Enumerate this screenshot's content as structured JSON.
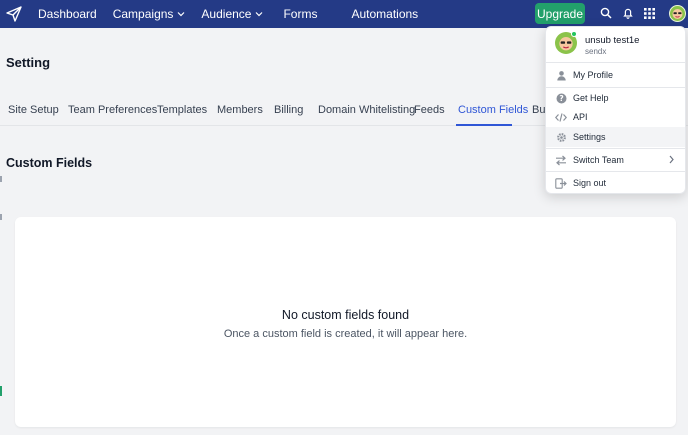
{
  "nav": {
    "items": [
      {
        "label": "Dashboard"
      },
      {
        "label": "Campaigns"
      },
      {
        "label": "Audience"
      },
      {
        "label": "Forms"
      },
      {
        "label": "Automations"
      }
    ],
    "upgrade_label": "Upgrade"
  },
  "page": {
    "title": "Setting",
    "section_title": "Custom Fields"
  },
  "tabs": [
    {
      "label": "Site Setup"
    },
    {
      "label": "Team Preferences"
    },
    {
      "label": "Templates"
    },
    {
      "label": "Members"
    },
    {
      "label": "Billing"
    },
    {
      "label": "Domain Whitelisting"
    },
    {
      "label": "Feeds"
    },
    {
      "label": "Custom Fields",
      "active": true
    },
    {
      "label": "Bul"
    }
  ],
  "empty_state": {
    "title": "No custom fields found",
    "subtitle": "Once a custom field is created, it will appear here."
  },
  "user_menu": {
    "name": "unsub test1e",
    "org": "sendx",
    "items": [
      {
        "label": "My Profile",
        "icon": "user-icon"
      },
      {
        "label": "Get Help",
        "icon": "help-icon"
      },
      {
        "label": "API",
        "icon": "code-icon"
      },
      {
        "label": "Settings",
        "icon": "gear-icon"
      },
      {
        "label": "Switch Team",
        "icon": "switch-icon"
      },
      {
        "label": "Sign out",
        "icon": "sign-out-icon"
      }
    ]
  },
  "colors": {
    "nav_bg": "#243a86",
    "accent": "#2f56d6",
    "upgrade": "#22a06b"
  }
}
